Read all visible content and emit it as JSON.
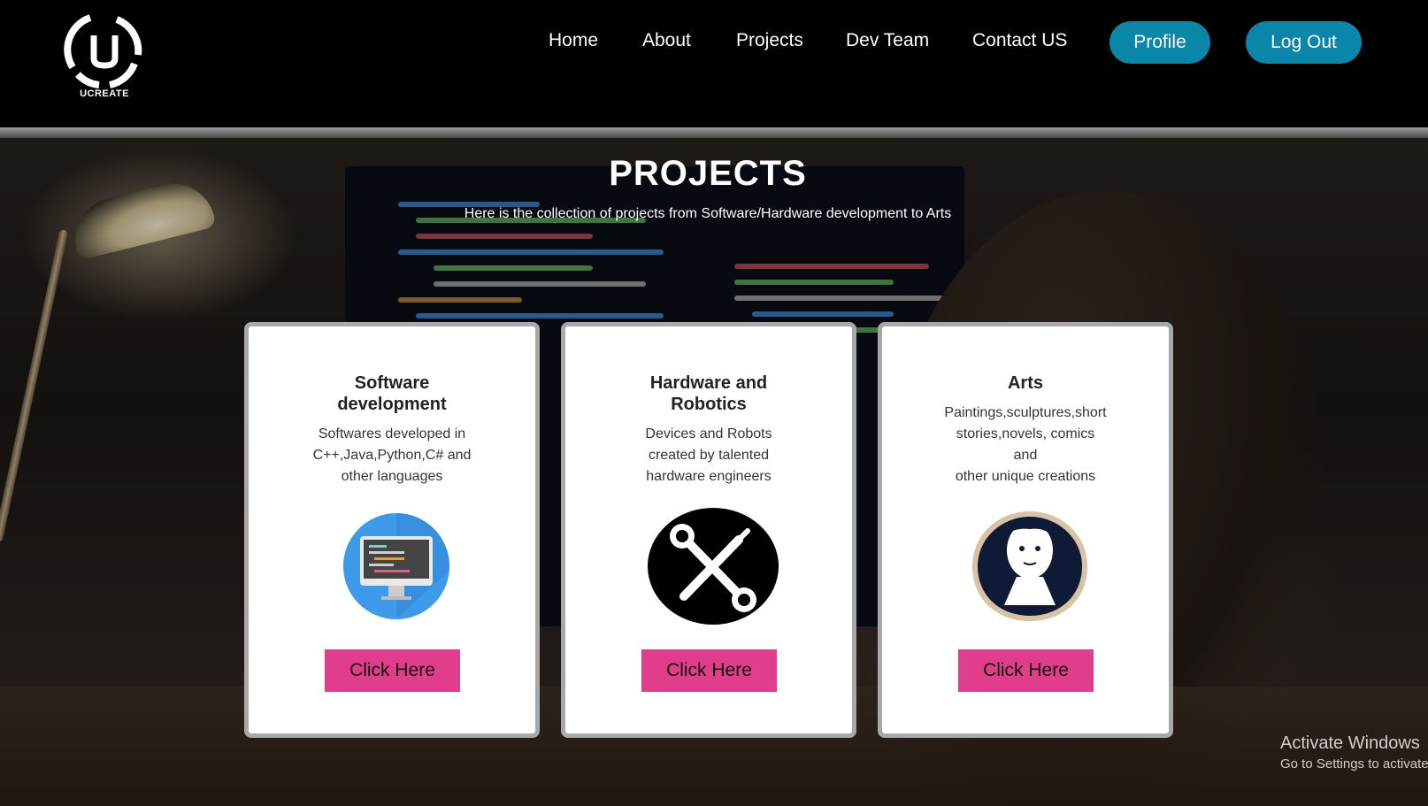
{
  "brand": {
    "name": "UCREATE",
    "logo_letter": "U"
  },
  "nav": {
    "home": "Home",
    "about": "About",
    "projects": "Projects",
    "dev_team": "Dev Team",
    "contact": "Contact US",
    "profile": "Profile",
    "logout": "Log Out"
  },
  "hero": {
    "title": "PROJECTS",
    "subtitle": "Here is the collection of projects from Software/Hardware development to Arts"
  },
  "cards": [
    {
      "title": "Software development",
      "desc_lines": [
        "Softwares developed in",
        "C++,Java,Python,C# and",
        "other languages"
      ],
      "icon": "computer-monitor-icon",
      "button": "Click Here"
    },
    {
      "title": "Hardware and Robotics",
      "desc_lines": [
        "Devices and Robots",
        "created by talented",
        "hardware engineers"
      ],
      "icon": "wrench-screwdriver-icon",
      "button": "Click Here"
    },
    {
      "title": "Arts",
      "desc_lines": [
        "Paintings,sculptures,short",
        "stories,novels, comics",
        "and",
        "other unique creations"
      ],
      "icon": "sculpture-bust-icon",
      "button": "Click Here"
    }
  ],
  "watermark": {
    "line1": "Activate Windows",
    "line2": "Go to Settings to activate"
  },
  "colors": {
    "nav_button": "#0a86a8",
    "card_button": "#e03e8c",
    "header_bg": "#000000"
  }
}
